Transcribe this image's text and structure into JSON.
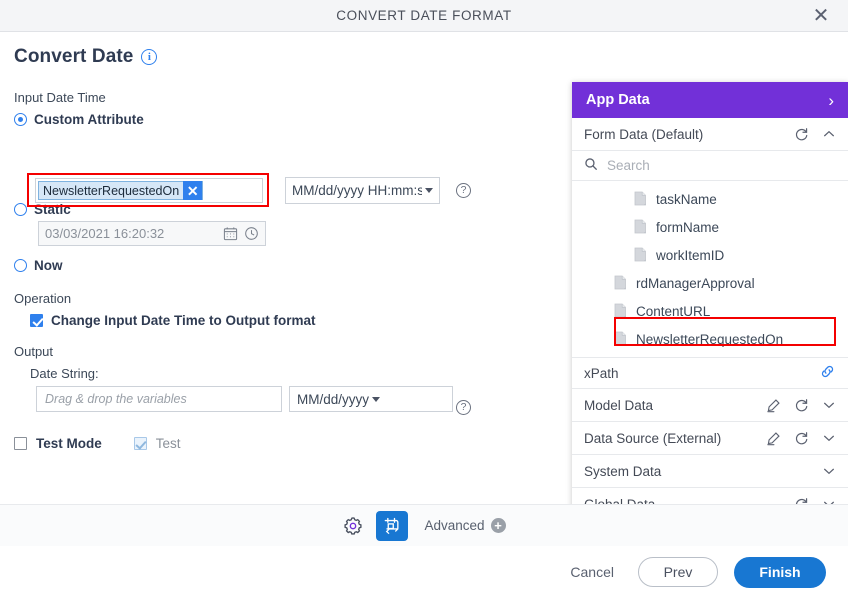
{
  "window": {
    "title": "CONVERT DATE FORMAT",
    "close_label": "✕"
  },
  "form": {
    "heading": "Convert Date",
    "info_icon_label": "i",
    "input_section_label": "Input Date Time",
    "options": {
      "custom_attribute_label": "Custom Attribute",
      "static_label": "Static",
      "now_label": "Now"
    },
    "custom_attribute": {
      "chip_value": "NewsletterRequestedOn",
      "chip_remove_label": "✕",
      "format_value": "MM/dd/yyyy HH:mm:s",
      "help_label": "?"
    },
    "static": {
      "value": "03/03/2021 16:20:32"
    },
    "operation": {
      "section_label": "Operation",
      "checkbox_label": "Change Input Date Time to Output format"
    },
    "output": {
      "section_label": "Output",
      "date_string_label": "Date String:",
      "input_placeholder": "Drag & drop the variables",
      "format_value": "MM/dd/yyyy",
      "help_label": "?"
    },
    "test": {
      "test_mode_label": "Test Mode",
      "test_label": "Test"
    }
  },
  "app_data": {
    "header": "App Data",
    "form_data": {
      "label": "Form Data (Default)",
      "search_placeholder": "Search",
      "items": [
        {
          "name": "taskName",
          "indent": 2
        },
        {
          "name": "formName",
          "indent": 2
        },
        {
          "name": "workItemID",
          "indent": 2
        },
        {
          "name": "rdManagerApproval",
          "indent": 1
        },
        {
          "name": "ContentURL",
          "indent": 1
        },
        {
          "name": "NewsletterRequestedOn",
          "indent": 1
        }
      ]
    },
    "xpath_label": "xPath",
    "sections": [
      {
        "label": "Model Data",
        "has_edit": true,
        "has_refresh": true
      },
      {
        "label": "Data Source (External)",
        "has_edit": true,
        "has_refresh": true
      },
      {
        "label": "System Data",
        "has_edit": false,
        "has_refresh": false
      },
      {
        "label": "Global Data",
        "has_edit": false,
        "has_refresh": true
      }
    ]
  },
  "toolbar": {
    "advanced_label": "Advanced"
  },
  "footer": {
    "cancel_label": "Cancel",
    "prev_label": "Prev",
    "finish_label": "Finish"
  },
  "colors": {
    "accent_purple": "#7230d8",
    "accent_blue": "#1877d2",
    "highlight_red": "#f40000"
  }
}
